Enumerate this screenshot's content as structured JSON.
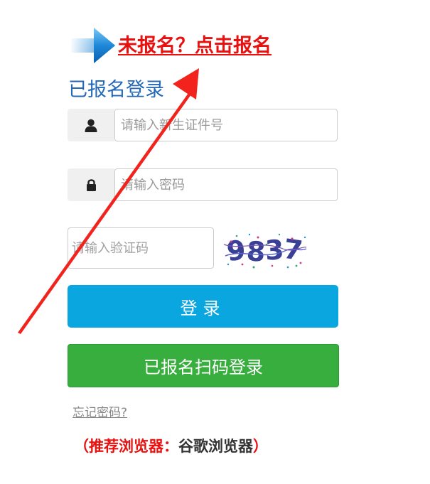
{
  "banner": {
    "register_link": "未报名？点击报名",
    "arrow_icon": "blue-right-arrow-icon"
  },
  "login": {
    "title": "已报名登录",
    "id_placeholder": "请输入新生证件号",
    "password_placeholder": "请输入密码",
    "captcha_placeholder": "请输入验证码",
    "captcha_code": "9837",
    "login_button": "登录",
    "qr_button": "已报名扫码登录",
    "forgot_password": "忘记密码?"
  },
  "browser_note": {
    "prefix": "（推荐浏览器：",
    "browser": "谷歌浏览器",
    "suffix": "）"
  },
  "colors": {
    "link_red": "#e8110f",
    "title_blue": "#2468b8",
    "login_blue": "#0aa6e0",
    "qr_green": "#38ae3e",
    "annotation_red": "#f2231c"
  },
  "icons": [
    "user-icon",
    "lock-icon",
    "blue-right-arrow-icon",
    "red-annotation-arrow"
  ]
}
